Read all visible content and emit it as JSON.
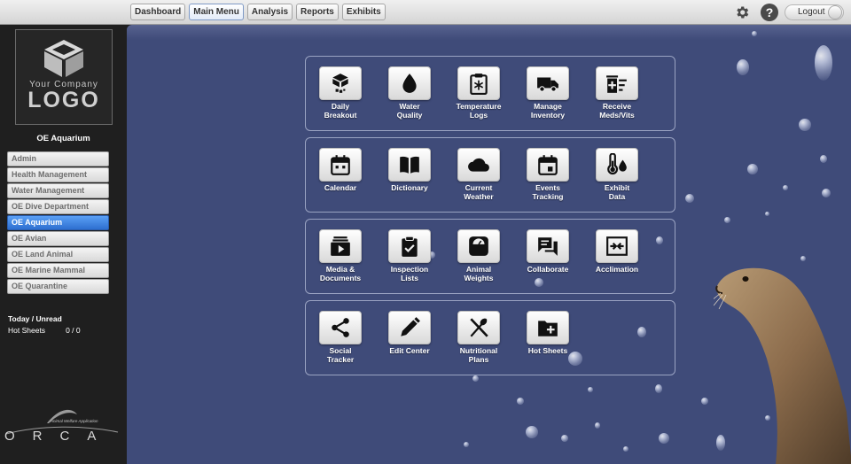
{
  "topbar": {
    "nav": [
      "Dashboard",
      "Main Menu",
      "Analysis",
      "Reports",
      "Exhibits"
    ],
    "active_nav": "Main Menu",
    "help_label": "?",
    "logout_label": "Logout"
  },
  "sidebar": {
    "logo_top": "Your Company",
    "logo_word": "LOGO",
    "title": "OE Aquarium",
    "items": [
      {
        "label": "Admin",
        "active": false
      },
      {
        "label": "Health Management",
        "active": false
      },
      {
        "label": "Water Management",
        "active": false
      },
      {
        "label": "OE Dive Department",
        "active": false
      },
      {
        "label": "OE Aquarium",
        "active": true
      },
      {
        "label": "OE Avian",
        "active": false
      },
      {
        "label": "OE Land Animal",
        "active": false
      },
      {
        "label": "OE Marine Mammal",
        "active": false
      },
      {
        "label": "OE Quarantine",
        "active": false
      }
    ],
    "today_label": "Today / Unread",
    "hot_sheets_label": "Hot Sheets",
    "hot_sheets_count": "0 / 0",
    "brand_tagline": "Animal Welfare Application",
    "brand_word": "ORCA"
  },
  "menu": {
    "rows": [
      [
        {
          "label1": "Daily",
          "label2": "Breakout",
          "icon": "food-bucket-icon"
        },
        {
          "label1": "Water",
          "label2": "Quality",
          "icon": "water-drop-icon"
        },
        {
          "label1": "Temperature",
          "label2": "Logs",
          "icon": "clipboard-snowflake-icon"
        },
        {
          "label1": "Manage",
          "label2": "Inventory",
          "icon": "truck-icon"
        },
        {
          "label1": "Receive",
          "label2": "Meds/Vits",
          "icon": "medical-kit-icon"
        }
      ],
      [
        {
          "label1": "Calendar",
          "label2": "",
          "icon": "calendar-icon"
        },
        {
          "label1": "Dictionary",
          "label2": "",
          "icon": "book-icon"
        },
        {
          "label1": "Current",
          "label2": "Weather",
          "icon": "cloud-icon"
        },
        {
          "label1": "Events",
          "label2": "Tracking",
          "icon": "event-calendar-icon"
        },
        {
          "label1": "Exhibit",
          "label2": "Data",
          "icon": "thermometer-drop-icon"
        }
      ],
      [
        {
          "label1": "Media &",
          "label2": "Documents",
          "icon": "media-library-icon"
        },
        {
          "label1": "Inspection",
          "label2": "Lists",
          "icon": "checklist-icon"
        },
        {
          "label1": "Animal",
          "label2": "Weights",
          "icon": "scale-icon"
        },
        {
          "label1": "Collaborate",
          "label2": "",
          "icon": "chat-icon"
        },
        {
          "label1": "Acclimation",
          "label2": "",
          "icon": "acclimation-icon"
        }
      ],
      [
        {
          "label1": "Social",
          "label2": "Tracker",
          "icon": "share-icon"
        },
        {
          "label1": "Edit Center",
          "label2": "",
          "icon": "pencil-icon"
        },
        {
          "label1": "Nutritional",
          "label2": "Plans",
          "icon": "utensils-icon"
        },
        {
          "label1": "Hot Sheets",
          "label2": "",
          "icon": "folder-plus-icon"
        }
      ]
    ]
  }
}
